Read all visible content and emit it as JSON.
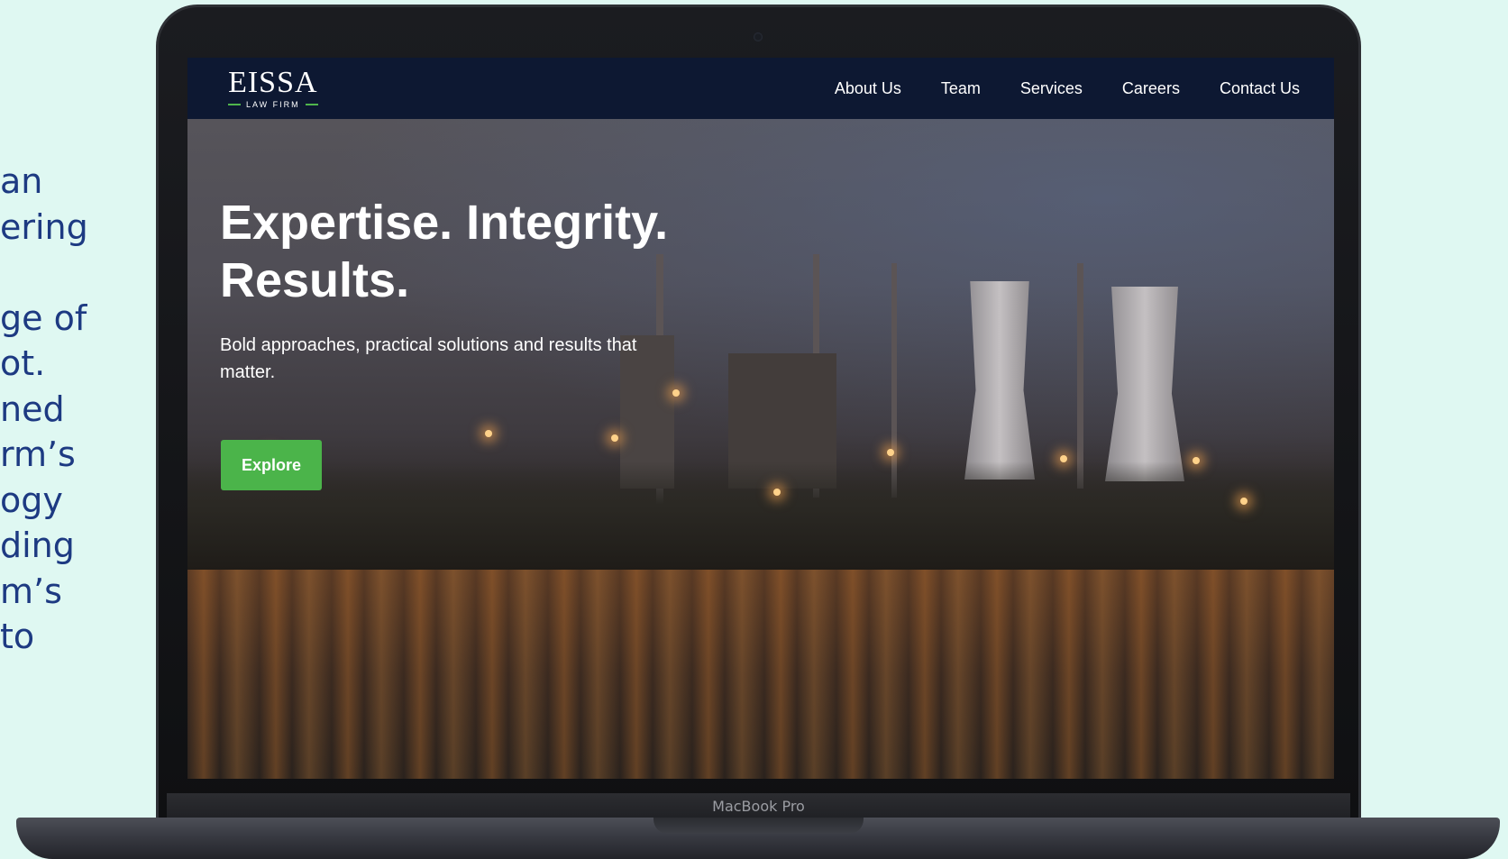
{
  "side_copy": {
    "lines": [
      " an",
      "ering",
      "",
      "ge of",
      "ot.",
      "ned",
      "rm’s",
      "ogy",
      "ding",
      "m’s",
      "to"
    ]
  },
  "laptop": {
    "brand_label": "MacBook Pro"
  },
  "site": {
    "logo": {
      "main": "EISSA",
      "sub": "LAW FIRM"
    },
    "nav": [
      {
        "label": "About Us"
      },
      {
        "label": "Team"
      },
      {
        "label": "Services"
      },
      {
        "label": "Careers"
      },
      {
        "label": "Contact Us"
      }
    ],
    "hero": {
      "title": "Expertise. Integrity. Results.",
      "subtitle": "Bold approaches, practical solutions and results that matter.",
      "cta_label": "Explore"
    }
  },
  "colors": {
    "page_bg": "#dff8f2",
    "side_text": "#1d3a82",
    "nav_bg": "#0d1832",
    "accent_green": "#4bb44a"
  }
}
